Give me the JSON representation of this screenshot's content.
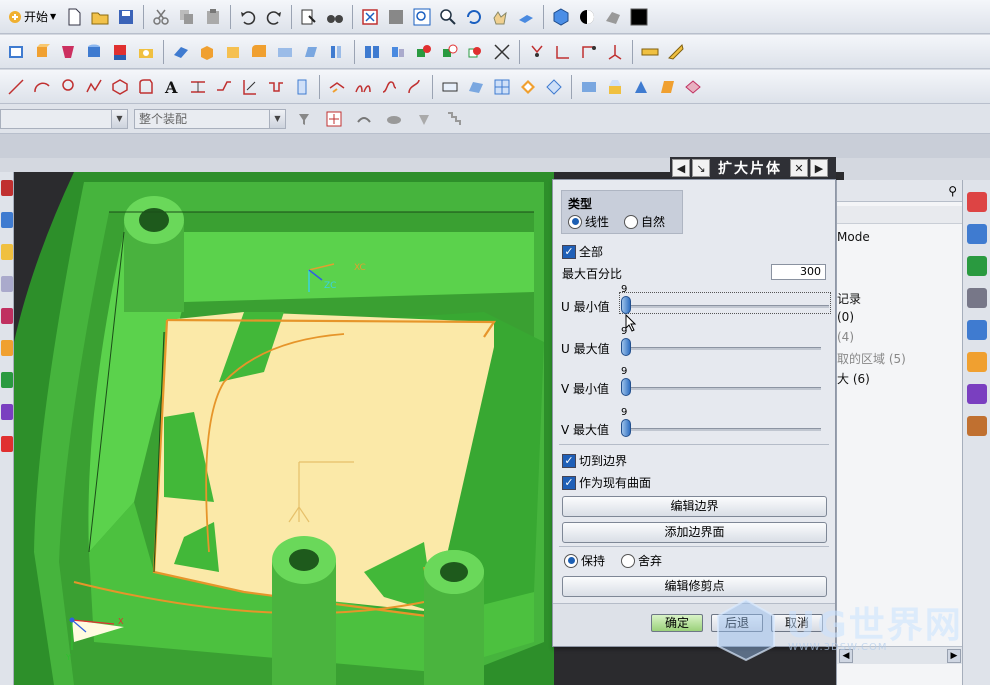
{
  "toolbar": {
    "start_label": "开始",
    "rows": [
      [
        "new-file-icon",
        "open-folder-icon",
        "save-icon",
        "cut-icon",
        "copy-icon",
        "paste-icon",
        "undo-icon",
        "redo-icon",
        "command-finder-icon",
        "binoculars-icon",
        "fit-view-icon",
        "zoom-window-icon",
        "zoom-icon",
        "zoom-in-icon",
        "rotate-icon",
        "pan-icon",
        "perspective-icon",
        "render-style-icon",
        "shading-icon",
        "edge-display-icon",
        "color-icon"
      ],
      [
        "sketch-book-icon",
        "extrude-icon",
        "revolve-icon",
        "cylinder-icon",
        "nx5-block-icon",
        "hole-icon",
        "datum-plane-icon",
        "box-icon",
        "shell-icon",
        "blend-icon",
        "chamfer-icon",
        "draft-icon",
        "offset-icon",
        "pattern-icon",
        "mirror-icon",
        "unite-icon",
        "subtract-icon",
        "intersect-icon",
        "trim-body-icon",
        "point-icon",
        "line-icon",
        "arc-icon",
        "csys-icon",
        "measure-icon",
        "ruler-icon"
      ],
      [
        "line-tool-icon",
        "arc-tool-icon",
        "spline-icon",
        "point-set-icon",
        "polygon-icon",
        "text-tool-icon",
        "offset-curve-icon",
        "project-curve-icon",
        "bridge-curve-icon",
        "intersect-curve-icon",
        "extract-curve-icon",
        "trim-curve-icon",
        "join-curve-icon",
        "surface-tool-icon",
        "through-curves-icon",
        "studio-surface-icon",
        "swept-icon",
        "mesh-surface-icon",
        "face-blend-icon",
        "enlarge-icon",
        "trim-sheet-icon",
        "extension-icon",
        "law-extension-icon",
        "sew-icon",
        "patch-icon"
      ]
    ],
    "row4": {
      "combo1_value": "",
      "combo2_value": "整个装配"
    }
  },
  "dialog": {
    "title": "扩大片体",
    "type_group": {
      "title": "类型",
      "option_linear": "线性",
      "option_natural": "自然",
      "selected": "线性"
    },
    "all_label": "全部",
    "all_checked": true,
    "max_percent_label": "最大百分比",
    "max_percent_value": "300",
    "sliders": [
      {
        "label": "U 最小值",
        "value": "9",
        "level": 0.0
      },
      {
        "label": "U 最大值",
        "value": "9",
        "level": 0.0
      },
      {
        "label": "V 最小值",
        "value": "9",
        "level": 0.0
      },
      {
        "label": "V 最大值",
        "value": "9",
        "level": 0.0
      }
    ],
    "trim_to_boundary_label": "切到边界",
    "as_existing_surface_label": "作为现有曲面",
    "edit_boundary_label": "编辑边界",
    "add_boundary_face_label": "添加边界面",
    "keep_label": "保持",
    "discard_label": "舍弃",
    "keep_selected": true,
    "edit_trim_points_label": "编辑修剪点",
    "ok_label": "确定",
    "back_label": "后退",
    "cancel_label": "取消"
  },
  "navigator": {
    "items": [
      {
        "text": "Mode",
        "dim": false
      },
      {
        "text": "记录",
        "dim": false
      },
      {
        "text": "(0)",
        "dim": false
      },
      {
        "text": "(4)",
        "dim": true
      },
      {
        "text": "取的区域 (5)",
        "dim": true
      },
      {
        "text": "大 (6)",
        "dim": false
      }
    ]
  },
  "viewport": {
    "axis_xc": "XC",
    "axis_zc": "ZC",
    "axis_x": "X",
    "axis_y": "Y"
  },
  "watermark": {
    "text": "UG世界网",
    "sub": "WWW.3DSW.COM"
  }
}
